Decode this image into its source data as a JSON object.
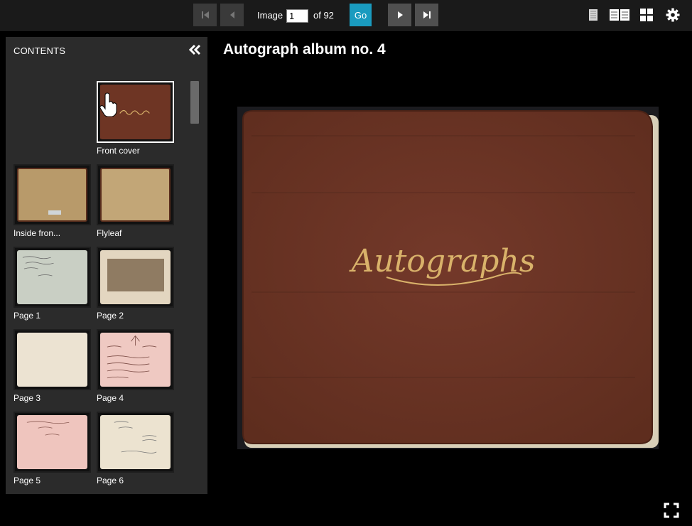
{
  "toolbar": {
    "image_label": "Image",
    "current_image": "1",
    "total_label": "of 92",
    "go_label": "Go"
  },
  "sidebar": {
    "title": "CONTENTS",
    "items": [
      {
        "label": "Front cover",
        "color": "#6e3524"
      },
      {
        "label": "Inside fron...",
        "color": "#b89a6a"
      },
      {
        "label": "Flyleaf",
        "color": "#c2a677"
      },
      {
        "label": "Page 1",
        "color": "#c9cfc4"
      },
      {
        "label": "Page 2",
        "color": "#e3d6c0"
      },
      {
        "label": "Page 3",
        "color": "#ece3d2"
      },
      {
        "label": "Page 4",
        "color": "#efc9c2"
      },
      {
        "label": "Page 5",
        "color": "#efc5be"
      },
      {
        "label": "Page 6",
        "color": "#ece3d0"
      }
    ]
  },
  "main": {
    "title": "Autograph album no. 4",
    "cover_text": "Autographs"
  },
  "colors": {
    "accent": "#1a9bbf",
    "cover_brown": "#6b3422",
    "cover_gold": "#d9b26a"
  }
}
